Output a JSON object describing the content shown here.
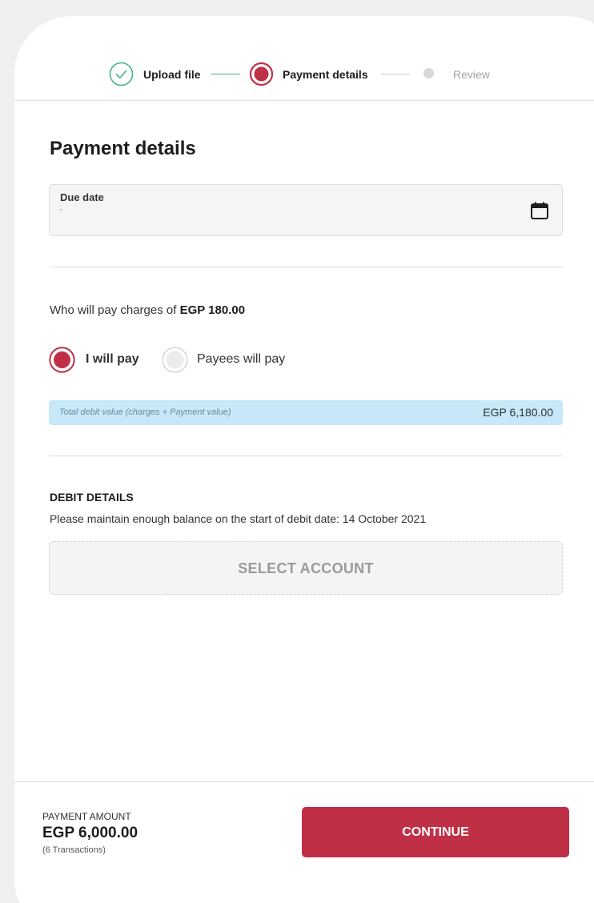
{
  "stepper": {
    "steps": [
      {
        "label": "Upload file",
        "state": "done"
      },
      {
        "label": "Payment details",
        "state": "active"
      },
      {
        "label": "Review",
        "state": "pending"
      }
    ]
  },
  "page_title": "Payment details",
  "due_date": {
    "label": "Due date",
    "value": "",
    "icon": "calendar-icon"
  },
  "charges": {
    "prefix": "Who will pay charges of",
    "amount": "EGP 180.00",
    "options": [
      {
        "label": "I will pay",
        "selected": true
      },
      {
        "label": "Payees will pay",
        "selected": false
      }
    ]
  },
  "total": {
    "label": "Total debit value (charges + Payment value)",
    "value": "EGP 6,180.00"
  },
  "debit": {
    "heading": "DEBIT DETAILS",
    "note": "Please maintain enough balance on the start of debit date: 14 October 2021",
    "select_label": "SELECT ACCOUNT"
  },
  "footer": {
    "payment_label": "PAYMENT AMOUNT",
    "payment_amount": "EGP 6,000.00",
    "transactions": "(6 Transactions)",
    "continue_label": "CONTINUE"
  },
  "colors": {
    "accent": "#bf3046",
    "done": "#43b38c",
    "info_bar": "#c6e8f8"
  }
}
